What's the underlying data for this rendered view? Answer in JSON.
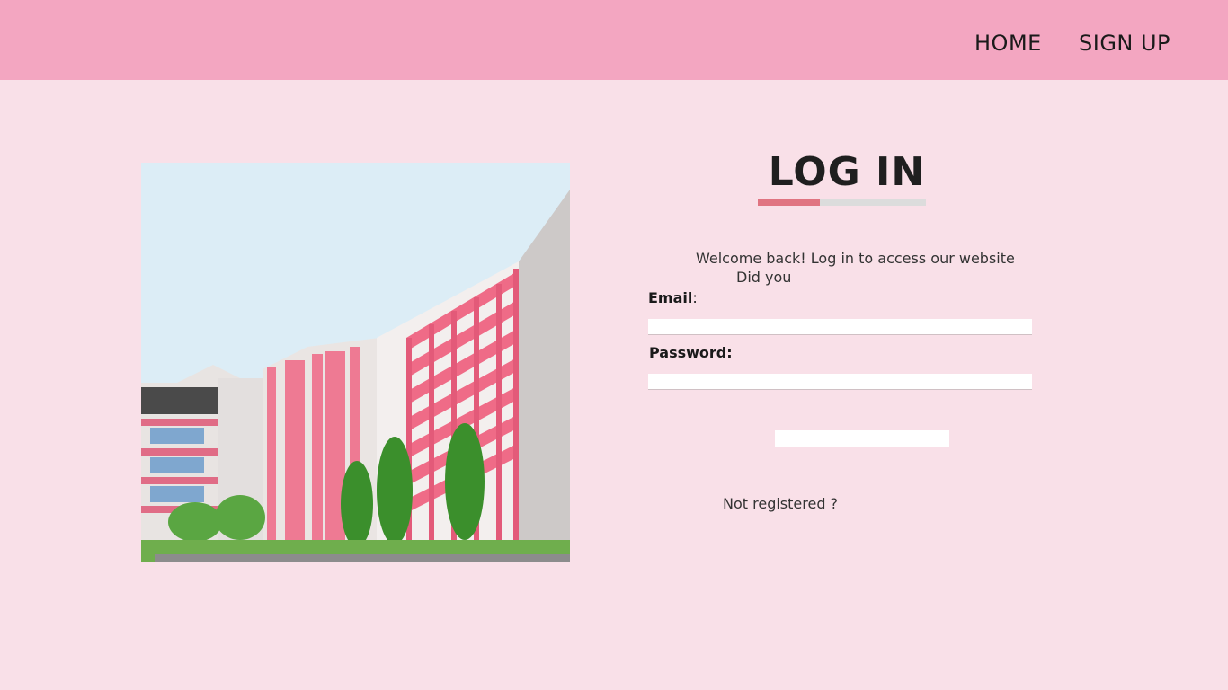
{
  "nav": {
    "home_label": "HOME",
    "signup_label": "SIGN UP"
  },
  "colors": {
    "navbar": "#f3a6c1",
    "page_background": "#f9e0e8",
    "accent": "#e07481"
  },
  "login": {
    "title": "LOG IN",
    "welcome_text": "Welcome back! Log in to access our website",
    "did_you_text": "Did you",
    "email_label": "Email",
    "email_colon": ":",
    "email_value": "",
    "password_label": "Password:",
    "password_value": "",
    "submit_label": "",
    "not_registered_text": "Not registered ?"
  },
  "image": {
    "icon": "building-photo"
  }
}
